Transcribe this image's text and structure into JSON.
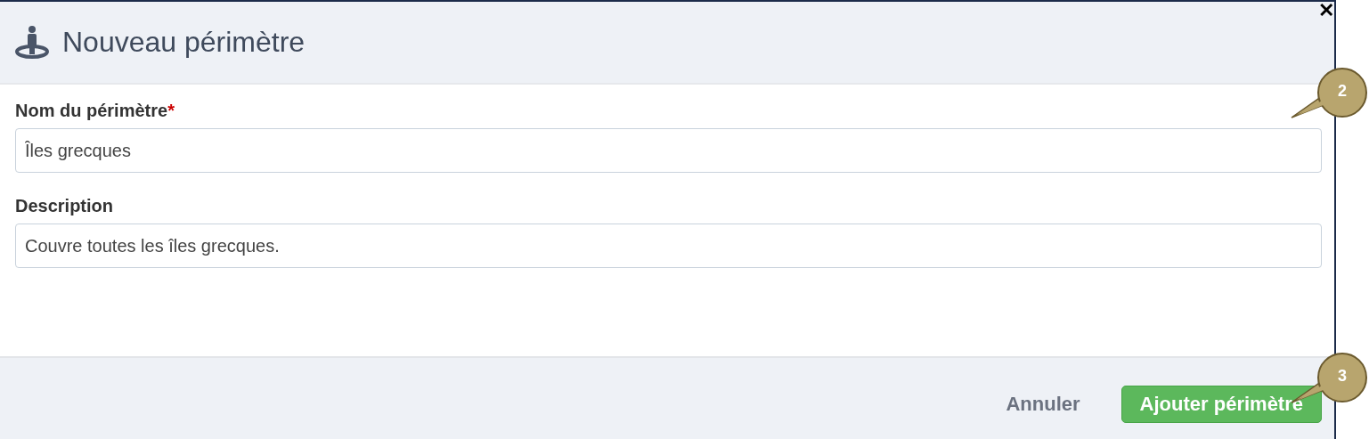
{
  "dialog": {
    "title": "Nouveau périmètre",
    "close": "✕"
  },
  "fields": [
    {
      "label": "Nom du périmètre",
      "required_mark": "*",
      "value": "Îles grecques"
    },
    {
      "label": "Description",
      "value": "Couvre toutes les îles grecques."
    }
  ],
  "buttons": [
    {
      "label": "Annuler",
      "kind": "link"
    },
    {
      "label": "Ajouter périmètre",
      "kind": "primary"
    }
  ],
  "callouts": [
    {
      "number": "2"
    },
    {
      "number": "3"
    }
  ]
}
